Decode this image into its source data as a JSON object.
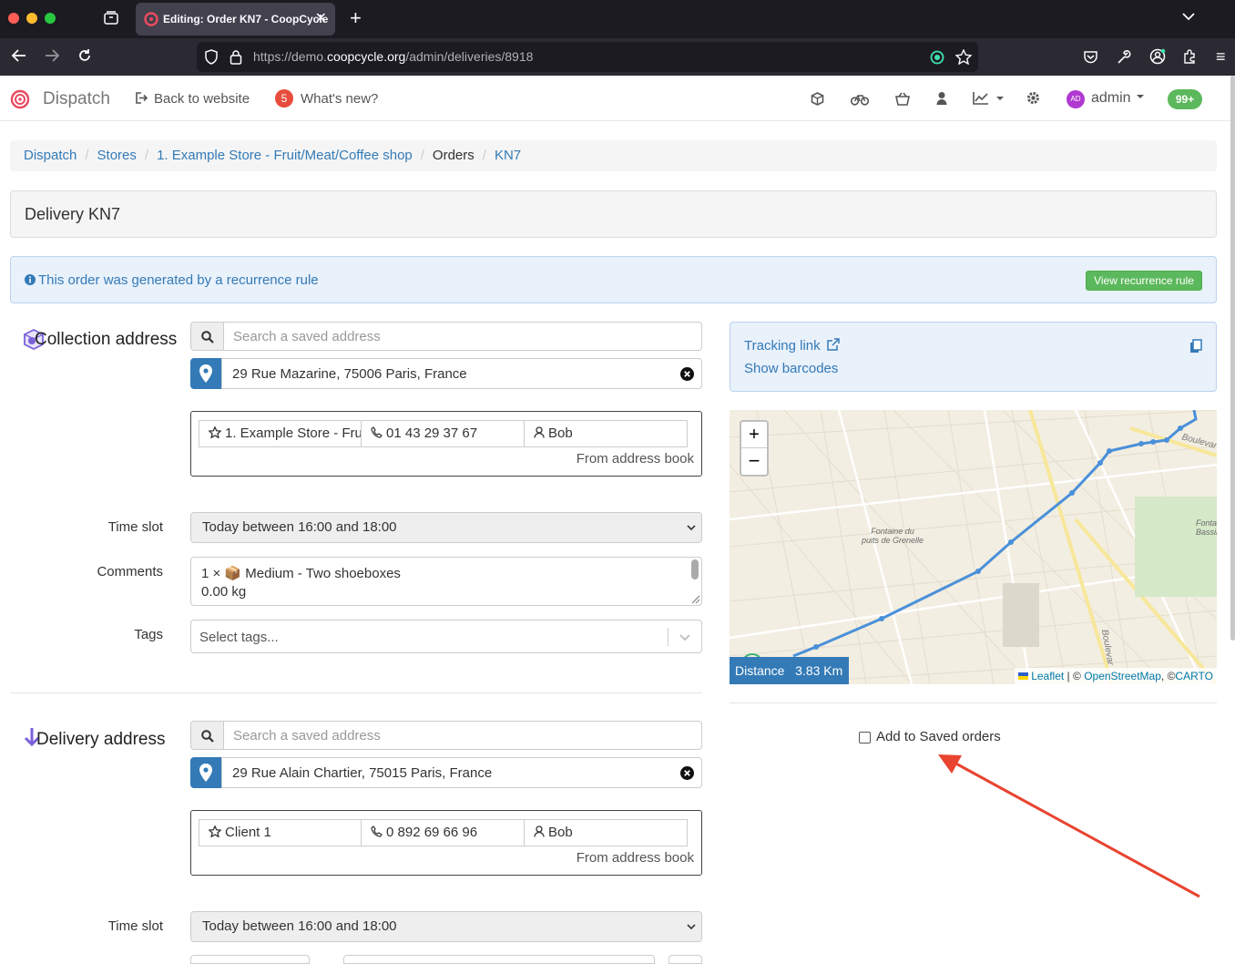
{
  "browser": {
    "tab_title": "Editing: Order KN7 - CoopCycle",
    "url_prefix": "https://demo.",
    "url_domain": "coopcycle.org",
    "url_path": "/admin/deliveries/8918"
  },
  "appnav": {
    "brand": "Dispatch",
    "back_to_website": "Back to website",
    "whats_new_count": "5",
    "whats_new": "What's new?",
    "user": "admin",
    "user_initials": "AD",
    "notifications": "99+"
  },
  "breadcrumb": {
    "items": [
      "Dispatch",
      "Stores",
      "1. Example Store - Fruit/Meat/Coffee shop",
      "Orders",
      "KN7"
    ]
  },
  "page": {
    "title": "Delivery KN7",
    "recurrence_notice": "This order was generated by a recurrence rule",
    "view_recurrence_button": "View recurrence rule"
  },
  "collection": {
    "heading": "Collection address",
    "search_placeholder": "Search a saved address",
    "address": "29 Rue Mazarine, 75006 Paris, France",
    "name": "1. Example Store - Fru",
    "phone": "01 43 29 37 67",
    "contact": "Bob",
    "from_address_book": "From address book",
    "time_slot_label": "Time slot",
    "time_slot_value": "Today between 16:00 and 18:00",
    "comments_label": "Comments",
    "comments_line1": "1 × 📦 Medium - Two shoeboxes",
    "comments_line2": "0.00 kg",
    "tags_label": "Tags",
    "tags_placeholder": "Select tags..."
  },
  "delivery": {
    "heading": "Delivery address",
    "search_placeholder": "Search a saved address",
    "address": "29 Rue Alain Chartier, 75015 Paris, France",
    "name": "Client 1",
    "phone": "0 892 69 66 96",
    "contact": "Bob",
    "from_address_book": "From address book",
    "time_slot_label": "Time slot",
    "time_slot_value": "Today between 16:00 and 18:00"
  },
  "sidebar": {
    "tracking_link": "Tracking link",
    "show_barcodes": "Show barcodes",
    "distance_label": "Distance",
    "distance_value": "3.83 Km",
    "attribution_leaflet": "Leaflet",
    "attribution_osm": "OpenStreetMap",
    "attribution_carto": "CARTO",
    "map_label_fontaine": "Fontaine du",
    "map_label_fontaine2": "puits de Grenelle",
    "map_label_fonta": "Fonta",
    "map_label_bassin": "Bassin",
    "map_label_boulevard": "Boulevard",
    "map_label_boulevar2": "Boulevar",
    "add_to_saved_orders": "Add to Saved orders"
  },
  "colors": {
    "link": "#337ab7",
    "success": "#5cb85c",
    "badge_red": "#e74c3c",
    "route": "#4a90d9",
    "annotation_arrow": "#e8442f"
  }
}
